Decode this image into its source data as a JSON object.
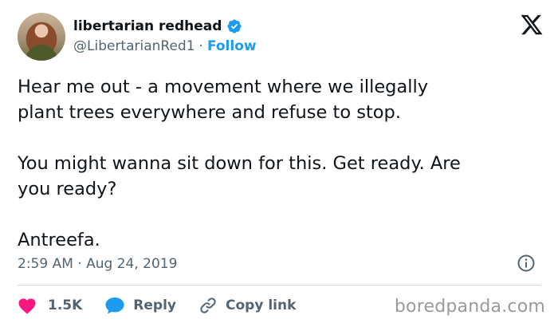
{
  "author": {
    "display_name": "libertarian redhead",
    "handle": "@LibertarianRed1",
    "separator": "·",
    "follow_label": "Follow",
    "verified_icon": "verified-badge-icon",
    "verified_color": "#1d9bf0"
  },
  "tweet": {
    "lines_para1": [
      "Hear me out - a movement where we illegally",
      "plant trees everywhere and refuse to stop."
    ],
    "lines_para2": [
      "You might wanna sit down for this. Get ready. Are",
      "you ready?"
    ],
    "lines_para3": [
      "Antreefa."
    ],
    "timestamp": "2:59 AM · Aug 24, 2019"
  },
  "actions": {
    "likes_count": "1.5K",
    "reply_label": "Reply",
    "copy_link_label": "Copy link",
    "like_color": "#f91880",
    "reply_color": "#1d9bf0"
  },
  "watermark": "boredpanda.com"
}
